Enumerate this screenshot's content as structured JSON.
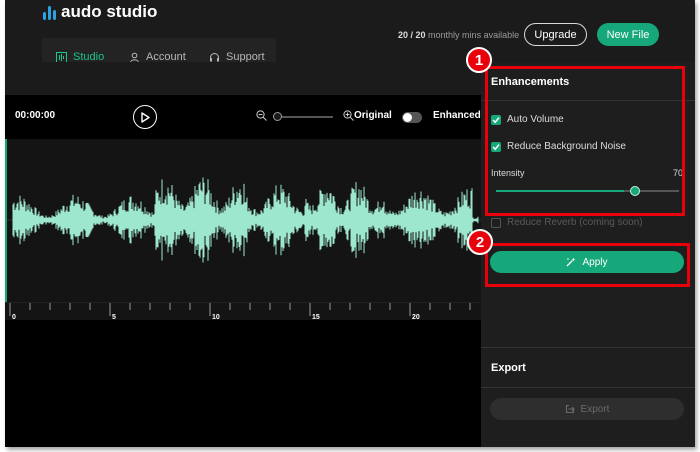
{
  "app": {
    "logo_text": "audo studio"
  },
  "header": {
    "mins_count": "20 / 20",
    "mins_text": "monthly mins available",
    "upgrade_label": "Upgrade",
    "new_file_label": "New File"
  },
  "nav": {
    "items": [
      {
        "label": "Studio",
        "icon": "studio-icon",
        "active": true
      },
      {
        "label": "Account",
        "icon": "user-icon",
        "active": false
      },
      {
        "label": "Support",
        "icon": "headset-icon",
        "active": false
      }
    ]
  },
  "player": {
    "time": "00:00:00",
    "original_label": "Original",
    "enhanced_label": "Enhanced",
    "enhanced_toggle": false
  },
  "timeline": {
    "ticks": [
      "0",
      "5",
      "10",
      "15",
      "20"
    ]
  },
  "panel": {
    "enhancements_title": "Enhancements",
    "auto_volume": {
      "label": "Auto Volume",
      "checked": true
    },
    "reduce_noise": {
      "label": "Reduce Background Noise",
      "checked": true
    },
    "intensity_label": "Intensity",
    "intensity_value": "70",
    "intensity_fraction": 0.7,
    "reduce_reverb": {
      "label": "Reduce Reverb (coming soon)",
      "checked": false
    },
    "apply_label": "Apply",
    "export_title": "Export",
    "export_label": "Export"
  },
  "annotations": {
    "badge_1": "1",
    "badge_2": "2"
  },
  "colors": {
    "accent": "#16a77b",
    "wave": "#9ee7cf",
    "highlight": "#e8000b",
    "background": "#1b1b1b"
  }
}
